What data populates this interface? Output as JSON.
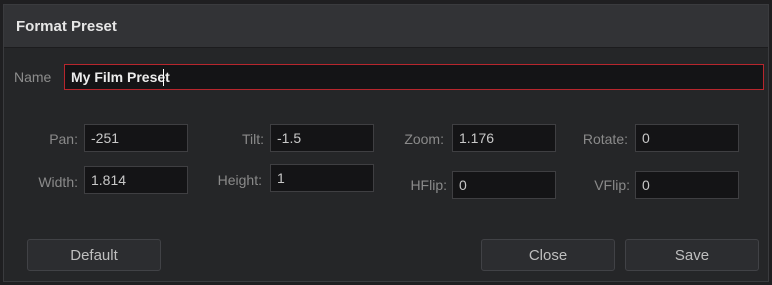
{
  "dialog": {
    "title": "Format Preset"
  },
  "name_field": {
    "label": "Name",
    "value": "My Film Preset"
  },
  "fields": {
    "pan": {
      "label": "Pan:",
      "value": "-251"
    },
    "tilt": {
      "label": "Tilt:",
      "value": "-1.5"
    },
    "zoom": {
      "label": "Zoom:",
      "value": "1.176"
    },
    "rotate": {
      "label": "Rotate:",
      "value": "0"
    },
    "width": {
      "label": "Width:",
      "value": "1.814"
    },
    "height": {
      "label": "Height:",
      "value": "1"
    },
    "hflip": {
      "label": "HFlip:",
      "value": "0"
    },
    "vflip": {
      "label": "VFlip:",
      "value": "0"
    }
  },
  "buttons": {
    "default": "Default",
    "close": "Close",
    "save": "Save"
  },
  "colors": {
    "focus_border": "#b8262d",
    "dialog_bg": "#252628",
    "titlebar_bg": "#323336"
  }
}
